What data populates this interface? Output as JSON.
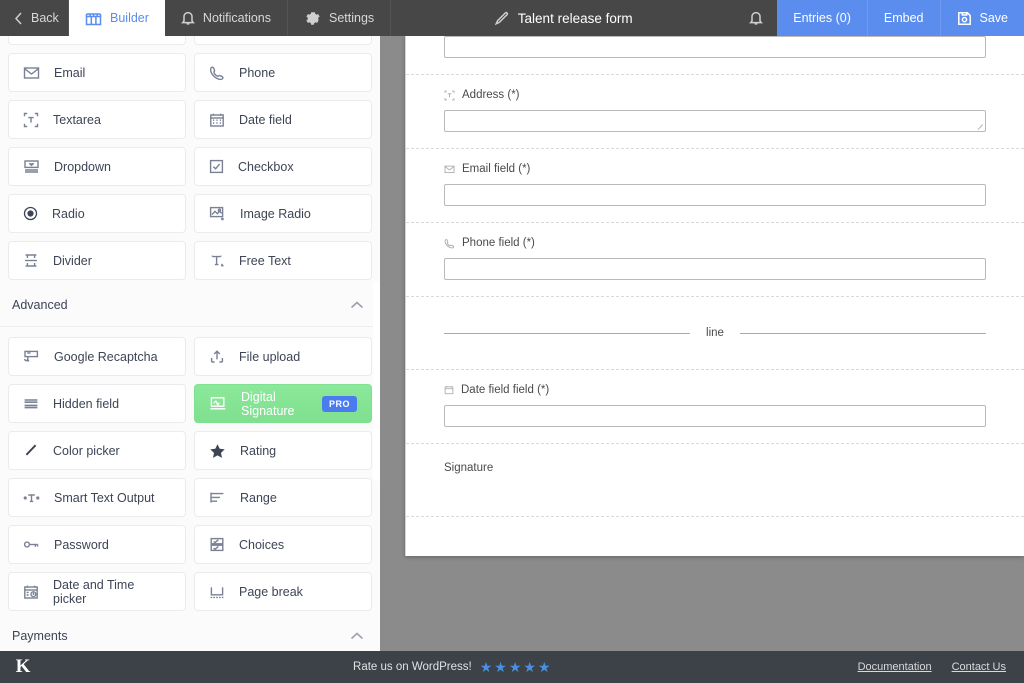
{
  "header": {
    "back_label": "Back",
    "tabs": [
      {
        "label": "Builder",
        "icon": "builder-icon",
        "active": true
      },
      {
        "label": "Notifications",
        "icon": "bell-icon",
        "active": false
      },
      {
        "label": "Settings",
        "icon": "gear-icon",
        "active": false
      }
    ],
    "form_title": "Talent release form",
    "title_icon": "edit-pencil-icon",
    "bell_icon": "bell-icon",
    "actions": [
      {
        "label": "Entries (0)",
        "icon": null
      },
      {
        "label": "Embed",
        "icon": null
      },
      {
        "label": "Save",
        "icon": "floppy-disk-icon"
      }
    ],
    "accent_blue": "#5a8dee",
    "bar_color": "#474747"
  },
  "sidebar": {
    "basic_fields": [
      {
        "label": "Email",
        "icon": "envelope-icon"
      },
      {
        "label": "Phone",
        "icon": "phone-icon"
      },
      {
        "label": "Textarea",
        "icon": "textarea-icon"
      },
      {
        "label": "Date field",
        "icon": "calendar-icon"
      },
      {
        "label": "Dropdown",
        "icon": "dropdown-icon"
      },
      {
        "label": "Checkbox",
        "icon": "checkbox-icon"
      },
      {
        "label": "Radio",
        "icon": "radio-icon"
      },
      {
        "label": "Image Radio",
        "icon": "image-radio-icon"
      },
      {
        "label": "Divider",
        "icon": "divider-icon"
      },
      {
        "label": "Free Text",
        "icon": "free-text-icon"
      }
    ],
    "advanced_section": {
      "title": "Advanced",
      "collapse_icon": "chevron-up-icon",
      "expanded": true
    },
    "advanced_fields": [
      {
        "label": "Google Recaptcha",
        "icon": "recaptcha-icon",
        "pro": false
      },
      {
        "label": "File upload",
        "icon": "upload-icon",
        "pro": false
      },
      {
        "label": "Hidden field",
        "icon": "hidden-field-icon",
        "pro": false
      },
      {
        "label": "Digital Signature",
        "icon": "signature-icon",
        "pro": true,
        "badge": "PRO"
      },
      {
        "label": "Color picker",
        "icon": "pencil-icon",
        "pro": false
      },
      {
        "label": "Rating",
        "icon": "star-icon",
        "pro": false
      },
      {
        "label": "Smart Text Output",
        "icon": "smart-text-icon",
        "pro": false
      },
      {
        "label": "Range",
        "icon": "range-icon",
        "pro": false
      },
      {
        "label": "Password",
        "icon": "key-icon",
        "pro": false
      },
      {
        "label": "Choices",
        "icon": "choices-icon",
        "pro": false
      },
      {
        "label": "Date and Time picker",
        "icon": "date-time-icon",
        "pro": false
      },
      {
        "label": "Page break",
        "icon": "page-break-icon",
        "pro": false
      }
    ],
    "payments_section": {
      "title": "Payments",
      "collapse_icon": "chevron-up-icon"
    },
    "pro_badge_color": "#4a7cf0",
    "pro_card_color": "#7fe08f"
  },
  "form_canvas": {
    "fields": [
      {
        "label": "Address (*)",
        "icon": "textarea-icon",
        "type": "textarea"
      },
      {
        "label": "Email field (*)",
        "icon": "envelope-icon",
        "type": "input"
      },
      {
        "label": "Phone field (*)",
        "icon": "phone-icon",
        "type": "input"
      },
      {
        "label": "line",
        "icon": null,
        "type": "divider"
      },
      {
        "label": "Date field field (*)",
        "icon": "calendar-icon",
        "type": "input"
      },
      {
        "label": "Signature",
        "icon": null,
        "type": "signature"
      }
    ]
  },
  "footer": {
    "logo": "K",
    "rate_text": "Rate us on WordPress!",
    "stars": 5,
    "star_color": "#4a90e2",
    "links": [
      {
        "label": "Documentation"
      },
      {
        "label": "Contact Us"
      }
    ]
  }
}
